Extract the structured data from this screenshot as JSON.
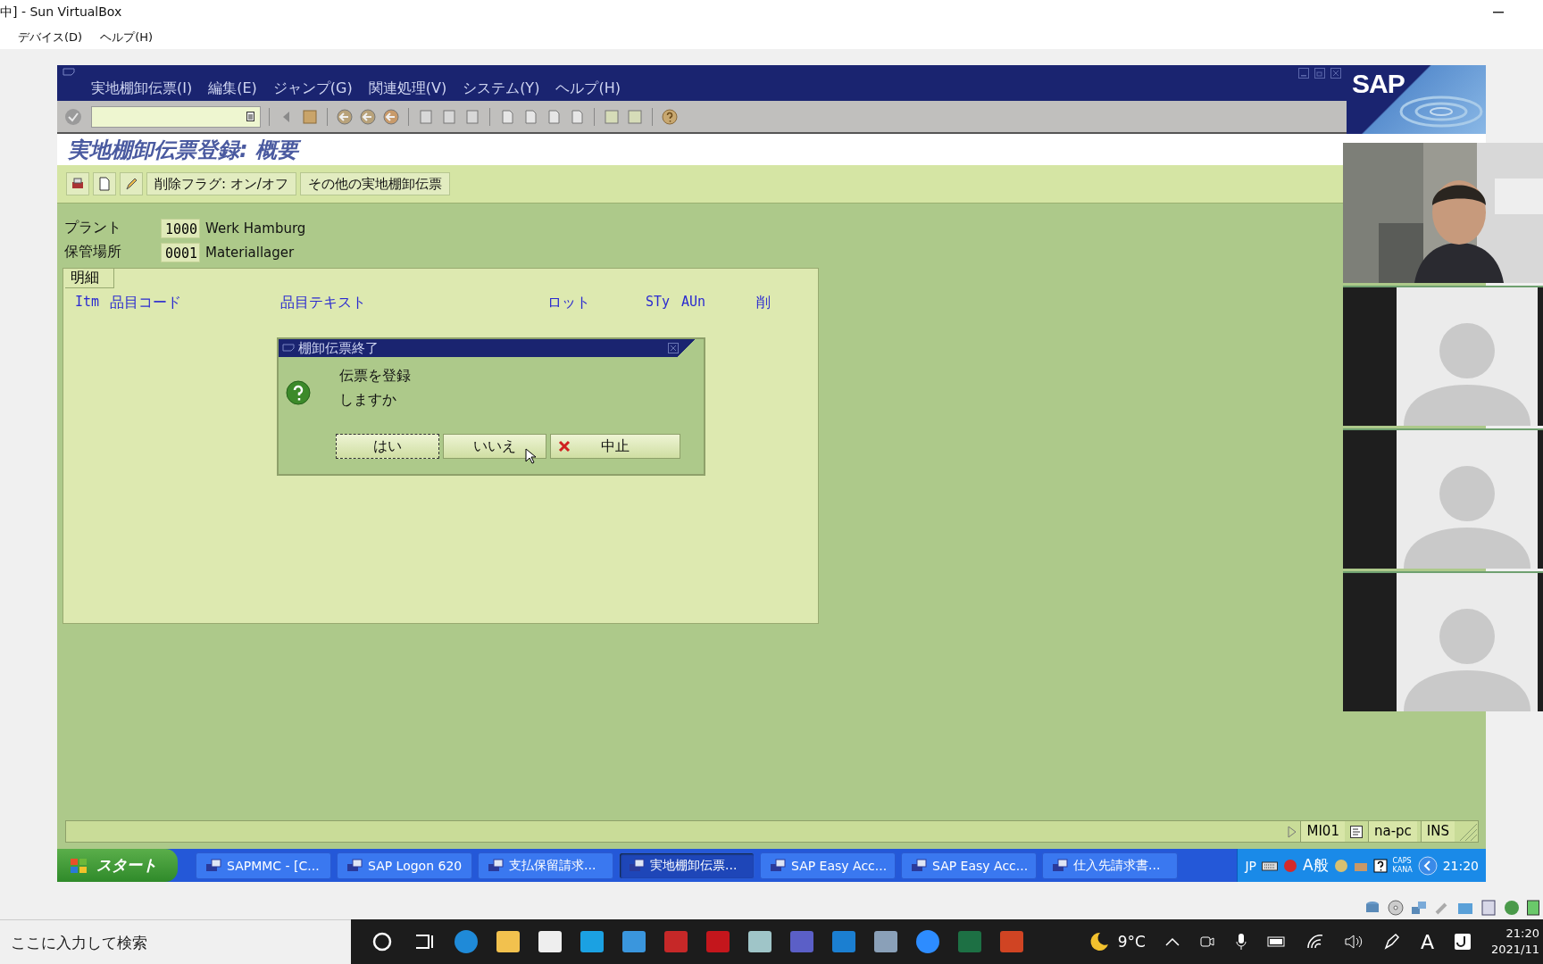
{
  "vbox": {
    "title": "中] - Sun VirtualBox",
    "menu": [
      "デバイス(D)",
      "ヘルプ(H)"
    ]
  },
  "sap": {
    "menu": [
      "実地棚卸伝票(I)",
      "編集(E)",
      "ジャンプ(G)",
      "関連処理(V)",
      "システム(Y)",
      "ヘルプ(H)"
    ],
    "logo": "SAP",
    "title": "実地棚卸伝票登録: 概要",
    "app_buttons": [
      "削除フラグ: オン/オフ",
      "その他の実地棚卸伝票"
    ],
    "fields": [
      {
        "label": "プラント",
        "value": "1000",
        "text": "Werk Hamburg"
      },
      {
        "label": "保管場所",
        "value": "0001",
        "text": "Materiallager"
      }
    ],
    "group": {
      "title": "明細",
      "columns": [
        "Itm",
        "品目コード",
        "品目テキスト",
        "ロット",
        "STy",
        "AUn",
        "削"
      ]
    },
    "dialog": {
      "title": "棚卸伝票終了",
      "message": [
        "伝票を登録",
        "しますか"
      ],
      "buttons": [
        {
          "label": "はい",
          "kind": "focused"
        },
        {
          "label": "いいえ",
          "kind": "plain"
        },
        {
          "label": "中止",
          "kind": "cancel"
        }
      ]
    },
    "status": {
      "transaction": "MI01",
      "server": "na-pc",
      "mode": "INS"
    },
    "taskbar": {
      "start": "スタート",
      "tasks": [
        {
          "label": "SAPMMC - [C...",
          "selected": false
        },
        {
          "label": "SAP Logon 620",
          "selected": false
        },
        {
          "label": "支払保留請求...",
          "selected": false
        },
        {
          "label": "実地棚卸伝票...",
          "selected": true
        },
        {
          "label": "SAP Easy Acc...",
          "selected": false
        },
        {
          "label": "SAP Easy Acc...",
          "selected": false
        },
        {
          "label": "仕入先請求書...",
          "selected": false
        }
      ],
      "lang": "JP",
      "ime": "A般",
      "caps": "CAPS",
      "kana": "KANA",
      "time": "21:20"
    }
  },
  "video": {
    "tiles": [
      {
        "kind": "picture"
      },
      {
        "kind": "avatar"
      },
      {
        "kind": "avatar"
      },
      {
        "kind": "avatar"
      }
    ]
  },
  "win": {
    "search": {
      "placeholder": "ここに入力して検索"
    },
    "temperature": "9°C",
    "ime": "A",
    "time": "21:20",
    "date": "2021/11"
  }
}
